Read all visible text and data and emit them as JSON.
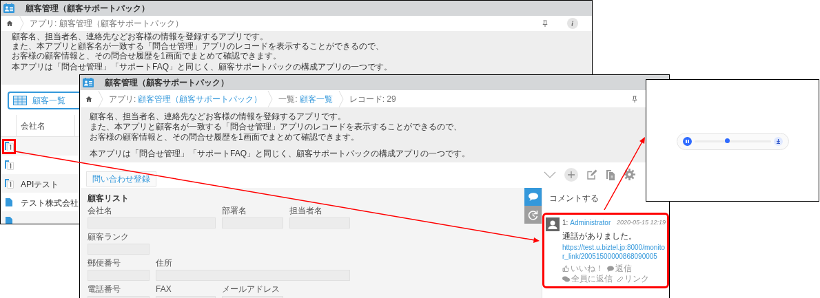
{
  "back_window": {
    "title": "顧客管理（顧客サポートパック）",
    "breadcrumb": "アプリ: 顧客管理（顧客サポートパック）",
    "description": [
      "顧客名、担当者名、連絡先などお客様の情報を登録するアプリです。",
      "また、本アプリと顧客名が一致する「問合せ管理」アプリのレコードを表示することができるので、",
      "お客様の顧客情報と、その問合せ履歴を1画面でまとめて確認できます。",
      "本アプリは「問合せ管理」「サポートFAQ」と同じく、顧客サポートパックの構成アプリの一つです。"
    ],
    "view_button": "顧客一覧",
    "table": {
      "columns": [
        "会社名"
      ],
      "rows": [
        {
          "kind": "group",
          "company": "",
          "callout": true
        },
        {
          "kind": "group",
          "company": "",
          "callout": false
        },
        {
          "kind": "group",
          "company": "APIテスト",
          "callout": false
        },
        {
          "kind": "document",
          "company": "テスト株式会社",
          "callout": false
        },
        {
          "kind": "document",
          "company": "",
          "callout": false
        }
      ]
    }
  },
  "front_window": {
    "title": "顧客管理（顧客サポートパック）",
    "breadcrumb": [
      {
        "prefix": "アプリ:",
        "link": "顧客管理（顧客サポートパック）"
      },
      {
        "prefix": "一覧:",
        "link": "顧客一覧"
      },
      {
        "prefix": "レコード: 29"
      }
    ],
    "description": [
      "顧客名、担当者名、連絡先などお客様の情報を登録するアプリです。",
      "また、本アプリと顧客名が一致する「問合せ管理」アプリのレコードを表示することができるので、",
      "お客様の顧客情報と、その問合せ履歴を1画面でまとめて確認できます。",
      "本アプリは「問合せ管理」「サポートFAQ」と同じく、顧客サポートパックの構成アプリの一つです。"
    ],
    "toolbar_button": "問い合わせ登録",
    "side_tabs": [
      {
        "kind": "comments",
        "selected": true
      },
      {
        "kind": "history",
        "selected": false
      }
    ],
    "form": {
      "title": "顧客リスト",
      "fields": [
        {
          "label": "会社名"
        },
        {
          "label": "部署名"
        },
        {
          "label": "担当者名"
        },
        {
          "label": "顧客ランク"
        },
        {
          "label": "郵便番号"
        },
        {
          "label": "住所"
        },
        {
          "label": "電話番号"
        },
        {
          "label": "FAX"
        },
        {
          "label": "メールアドレス"
        }
      ]
    },
    "comments": {
      "prompt": "コメントする",
      "items": [
        {
          "number": "1:",
          "author": "Administrator",
          "date": "2020-05-15 12:19",
          "text": "通話がありました。",
          "link": "https://test.u.biztel.jp:8000/monitor_link/20051500000868090005",
          "actions": [
            "いいね！",
            "返信",
            "全員に返信",
            "リンク"
          ],
          "callout": true
        }
      ]
    }
  },
  "player": {
    "level": 0.43
  }
}
